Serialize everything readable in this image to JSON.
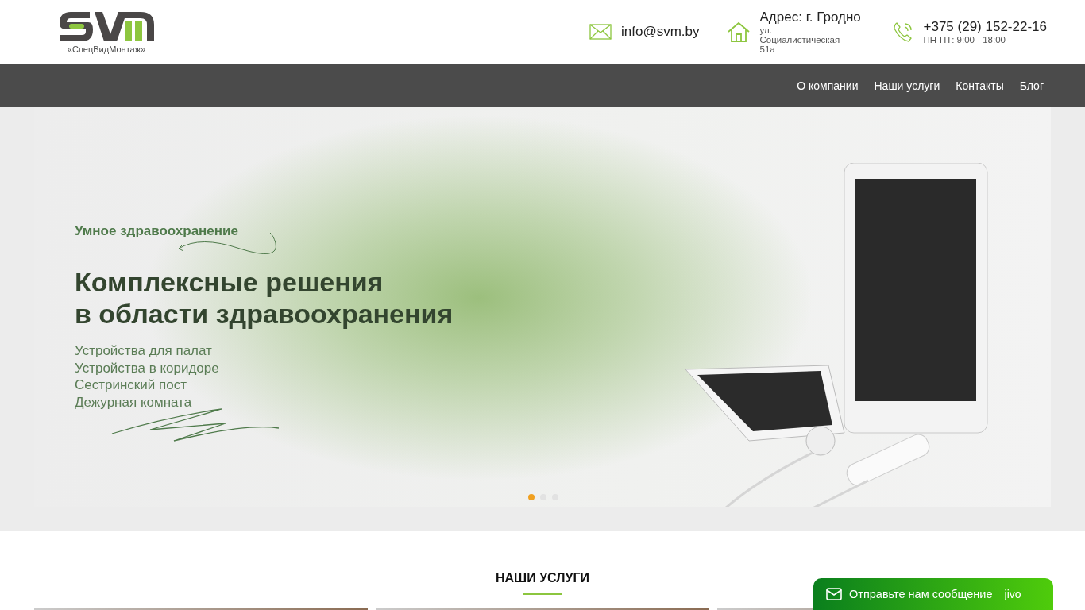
{
  "header": {
    "logo_caption": "«СпецВидМонтаж»",
    "email": "info@svm.by",
    "address_title": "Адрес: г. Гродно",
    "address_lines": [
      "ул.",
      "Социалистическая",
      "51а"
    ],
    "phone": "+375 (29) 152-22-16",
    "hours": "ПН-ПТ: 9:00 - 18:00"
  },
  "nav": [
    "О компании",
    "Наши услуги",
    "Контакты",
    "Блог"
  ],
  "hero": {
    "eyebrow": "Умное здравоохранение",
    "title_lines": [
      "Комплексные решения",
      "в области здравоохранения"
    ],
    "items": [
      "Устройства для палат",
      "Устройства в коридоре",
      "Сестринский пост",
      "Дежурная комната"
    ],
    "dots": [
      {
        "selected": true
      },
      {
        "selected": false
      },
      {
        "selected": false
      }
    ]
  },
  "services": {
    "heading": "НАШИ УСЛУГИ"
  },
  "chat": {
    "label": "Отправьте нам сообщение",
    "brand": "jivo"
  }
}
